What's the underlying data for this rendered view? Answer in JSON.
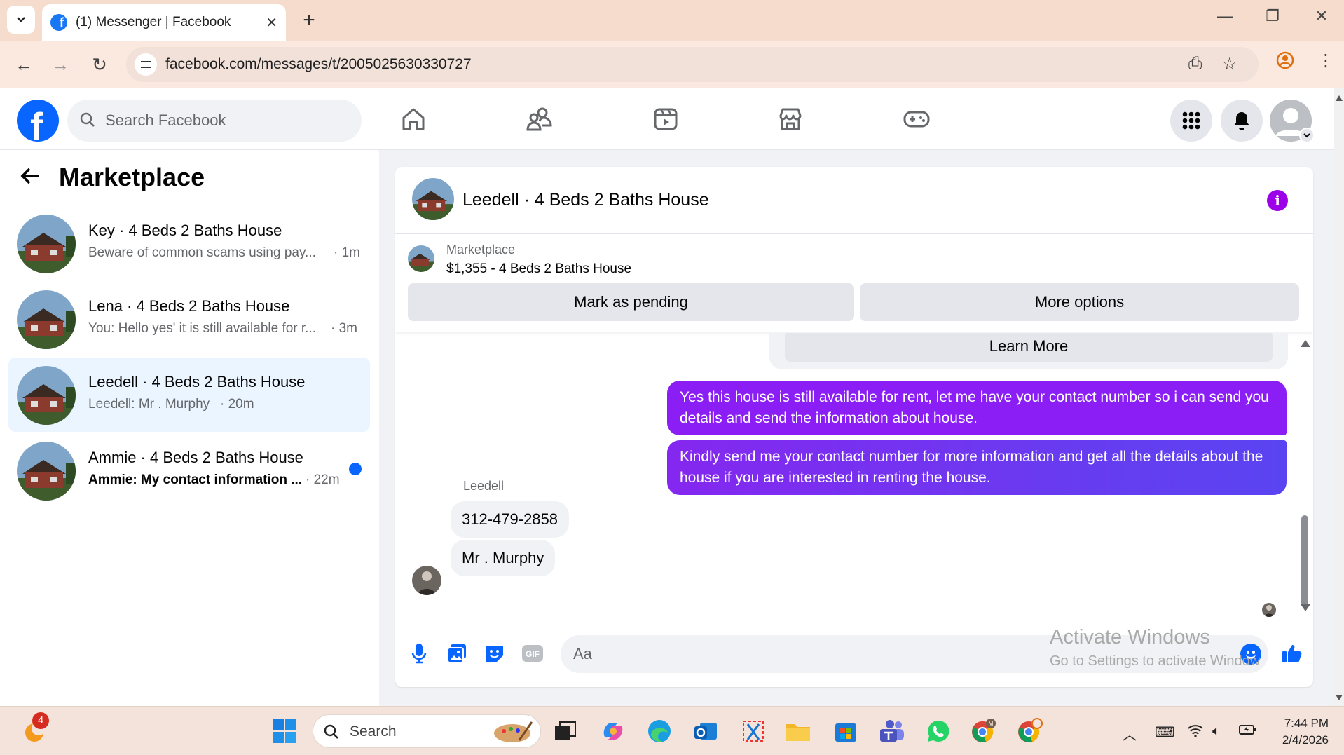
{
  "browser": {
    "tab_title": "(1) Messenger | Facebook",
    "url": "facebook.com/messages/t/2005025630330727"
  },
  "facebook": {
    "search_placeholder": "Search Facebook"
  },
  "left_panel": {
    "title": "Marketplace",
    "conversations": [
      {
        "name": "Key · 4 Beds 2 Baths House",
        "preview": "Beware of common scams using pay...",
        "time": "· 1m",
        "active": false,
        "unread": false
      },
      {
        "name": "Lena · 4 Beds 2 Baths House",
        "preview": "You: Hello yes' it is still available for r...",
        "time": "· 3m",
        "active": false,
        "unread": false
      },
      {
        "name": "Leedell · 4 Beds 2 Baths House",
        "preview": "Leedell: Mr . Murphy",
        "time": "· 20m",
        "active": true,
        "unread": false
      },
      {
        "name": "Ammie · 4 Beds 2 Baths House",
        "preview": "Ammie: My contact information ...",
        "time": "· 22m",
        "active": false,
        "unread": true
      }
    ]
  },
  "chat": {
    "title": "Leedell · 4 Beds 2 Baths House",
    "marketplace_label": "Marketplace",
    "listing": "$1,355 - 4 Beds 2 Baths House",
    "mark_pending": "Mark as pending",
    "more_options": "More options",
    "learn_more": "Learn More",
    "outgoing": [
      "Yes this house is still available for rent, let me have your contact number so i can send you details and send the information about house.",
      "Kindly send me your contact number for more information and get all the details about the house if you are interested in renting the house."
    ],
    "sender_name": "Leedell",
    "incoming": [
      "312-479-2858",
      "Mr . Murphy"
    ],
    "composer_placeholder": "Aa"
  },
  "watermark": {
    "line1": "Activate Windows",
    "line2": "Go to Settings to activate Windows."
  },
  "taskbar": {
    "search_label": "Search",
    "notification_count": "4",
    "time": "7:44 PM",
    "date": "2/4/2026"
  },
  "colors": {
    "facebook_blue": "#0866ff",
    "outgoing_bubble": "#8b1df5",
    "info_purple": "#9b00e8",
    "active_conv_bg": "#ebf5ff"
  }
}
